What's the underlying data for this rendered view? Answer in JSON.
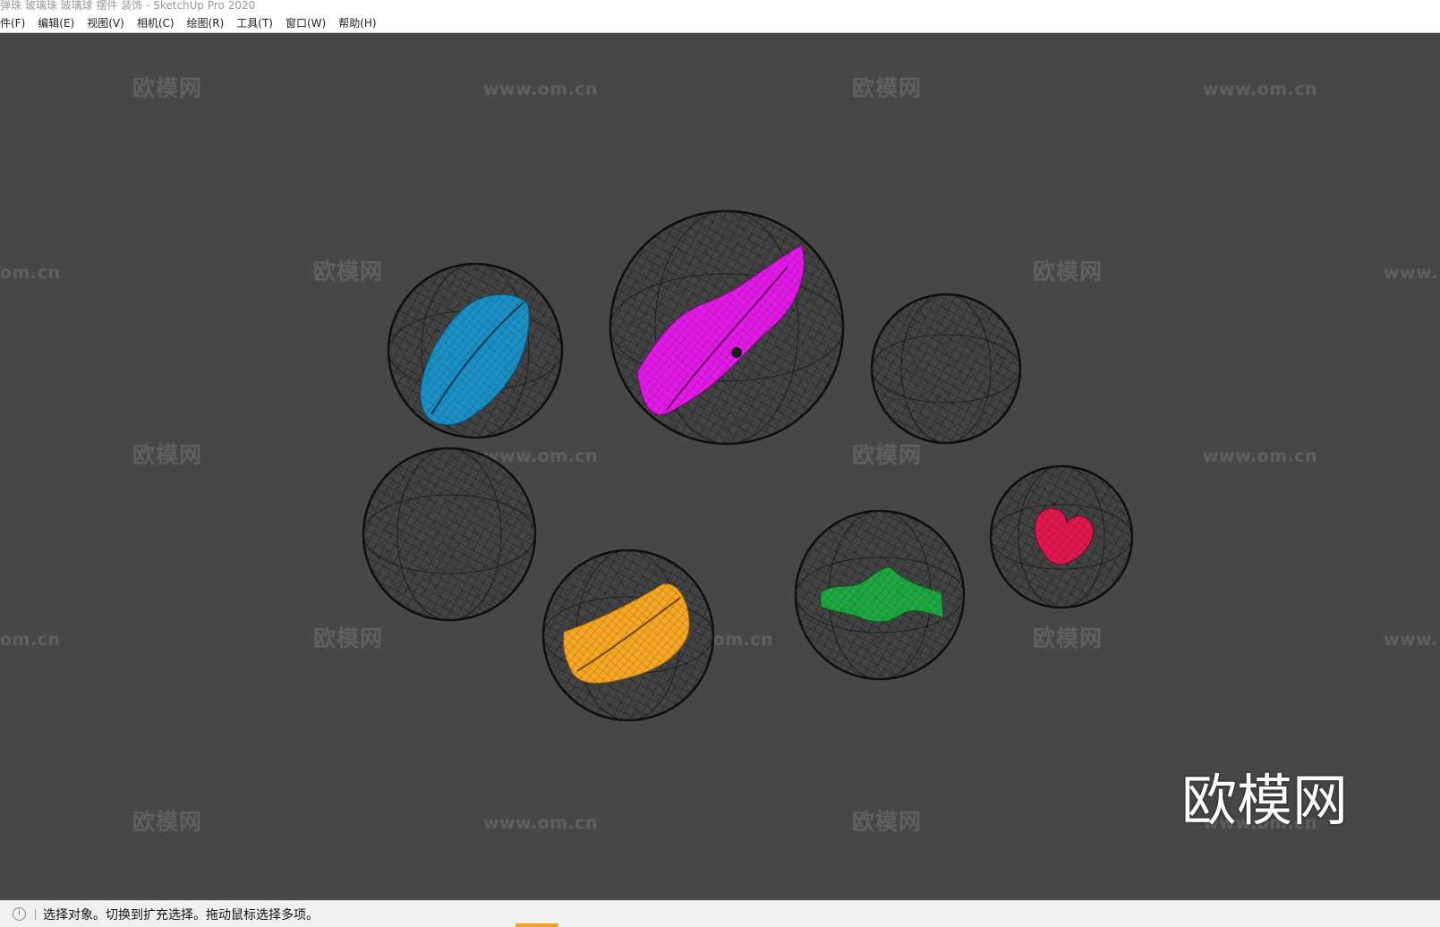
{
  "window": {
    "title": "弹珠 玻璃珠 玻璃球 摆件 装饰 - SketchUp Pro 2020"
  },
  "menubar": {
    "items": [
      {
        "id": "file",
        "label": "件(F)"
      },
      {
        "id": "edit",
        "label": "编辑(E)"
      },
      {
        "id": "view",
        "label": "视图(V)"
      },
      {
        "id": "camera",
        "label": "相机(C)"
      },
      {
        "id": "draw",
        "label": "绘图(R)"
      },
      {
        "id": "tools",
        "label": "工具(T)"
      },
      {
        "id": "window",
        "label": "窗口(W)"
      },
      {
        "id": "help",
        "label": "帮助(H)"
      }
    ]
  },
  "viewport": {
    "background": "#474747",
    "watermark_cn": "欧模网",
    "watermark_en": "www.om.cn",
    "watermark_en_cut_left": "om.cn",
    "watermark_en_cut_right": "www.",
    "logo_text": "欧模网",
    "marbles": [
      {
        "id": "blue-leaf",
        "insert": "leaf",
        "color": "#1a8fc4"
      },
      {
        "id": "magenta-twist",
        "insert": "twist",
        "color": "#e21ae6"
      },
      {
        "id": "plain-top",
        "insert": "none",
        "color": ""
      },
      {
        "id": "plain-left",
        "insert": "none",
        "color": ""
      },
      {
        "id": "orange-leaf",
        "insert": "leaf",
        "color": "#f5a623"
      },
      {
        "id": "green-wave",
        "insert": "wave",
        "color": "#1ea640"
      },
      {
        "id": "red-heart",
        "insert": "heart",
        "color": "#e0174d"
      }
    ]
  },
  "statusbar": {
    "message": "选择对象。切换到扩充选择。拖动鼠标选择多项。"
  }
}
